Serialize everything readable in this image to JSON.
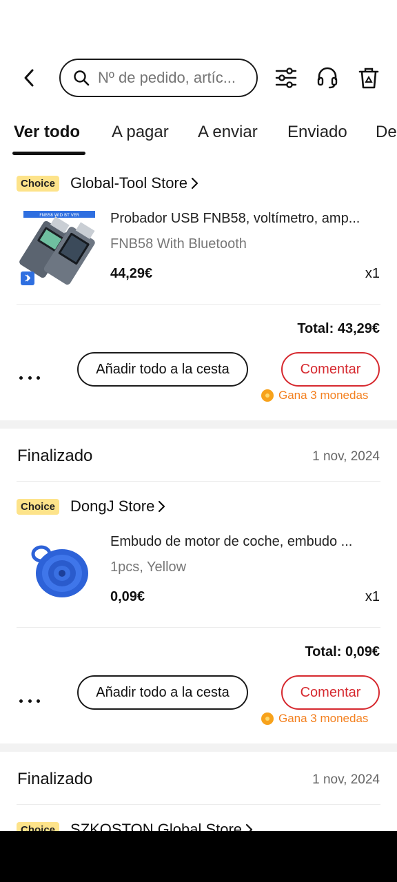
{
  "header": {
    "search_placeholder": "Nº de pedido, artíc..."
  },
  "tabs": [
    {
      "label": "Ver todo",
      "active": true
    },
    {
      "label": "A pagar",
      "active": false
    },
    {
      "label": "A enviar",
      "active": false
    },
    {
      "label": "Enviado",
      "active": false
    },
    {
      "label": "De",
      "active": false
    }
  ],
  "orders": [
    {
      "badge": "Choice",
      "store": "Global-Tool Store",
      "product_title": "Probador USB FNB58, voltímetro, amp...",
      "variant": "FNB58 With Bluetooth",
      "price": "44,29€",
      "qty": "x1",
      "total": "Total: 43,29€",
      "cart_button": "Añadir todo a la cesta",
      "comment_button": "Comentar",
      "coins": "Gana 3 monedas"
    },
    {
      "status": "Finalizado",
      "date": "1 nov, 2024",
      "badge": "Choice",
      "store": "DongJ Store",
      "product_title": "Embudo de motor de coche, embudo ...",
      "variant": "1pcs, Yellow",
      "price": "0,09€",
      "qty": "x1",
      "total": "Total: 0,09€",
      "cart_button": "Añadir todo a la cesta",
      "comment_button": "Comentar",
      "coins": "Gana 3 monedas"
    },
    {
      "status": "Finalizado",
      "date": "1 nov, 2024",
      "badge": "Choice",
      "store": "SZKOSTON Global Store"
    }
  ],
  "colors": {
    "accent": "#d6292f",
    "coins": "#f3801f",
    "choice_badge": "#fde38a"
  }
}
